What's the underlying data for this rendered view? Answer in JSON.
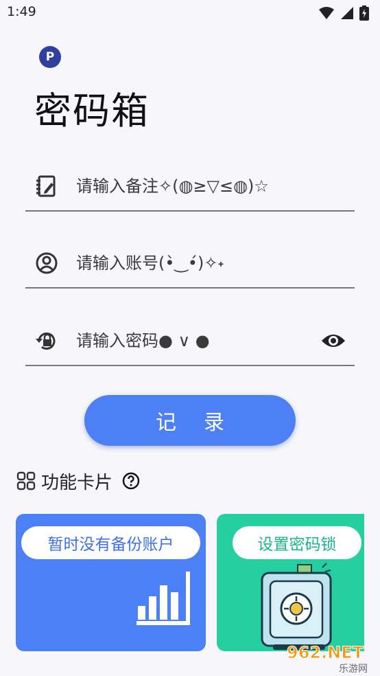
{
  "status_bar": {
    "time": "1:49"
  },
  "app": {
    "logo_letter": "P",
    "title": "密码箱"
  },
  "form": {
    "note_placeholder": "请输入备注✧(◍≥▽≤◍)☆",
    "account_placeholder": "请输入账号(•̀‿•́)✧˖",
    "password_placeholder": "请输入密码● ∨ ●",
    "record_label": "记录"
  },
  "cards": {
    "section_title": "功能卡片",
    "backup_label": "暂时没有备份账户",
    "lock_label": "设置密码锁"
  },
  "watermark": {
    "text": "962.NET",
    "subtext": "乐游网"
  },
  "colors": {
    "accent": "#4d80f5",
    "green": "#25cf9f",
    "logo": "#2f3f9e"
  },
  "icons": [
    "wifi-icon",
    "signal-icon",
    "battery-icon",
    "note-icon",
    "account-icon",
    "lock-reset-icon",
    "eye-icon",
    "grid-icon",
    "help-icon",
    "bar-chart-icon",
    "safe-icon"
  ]
}
